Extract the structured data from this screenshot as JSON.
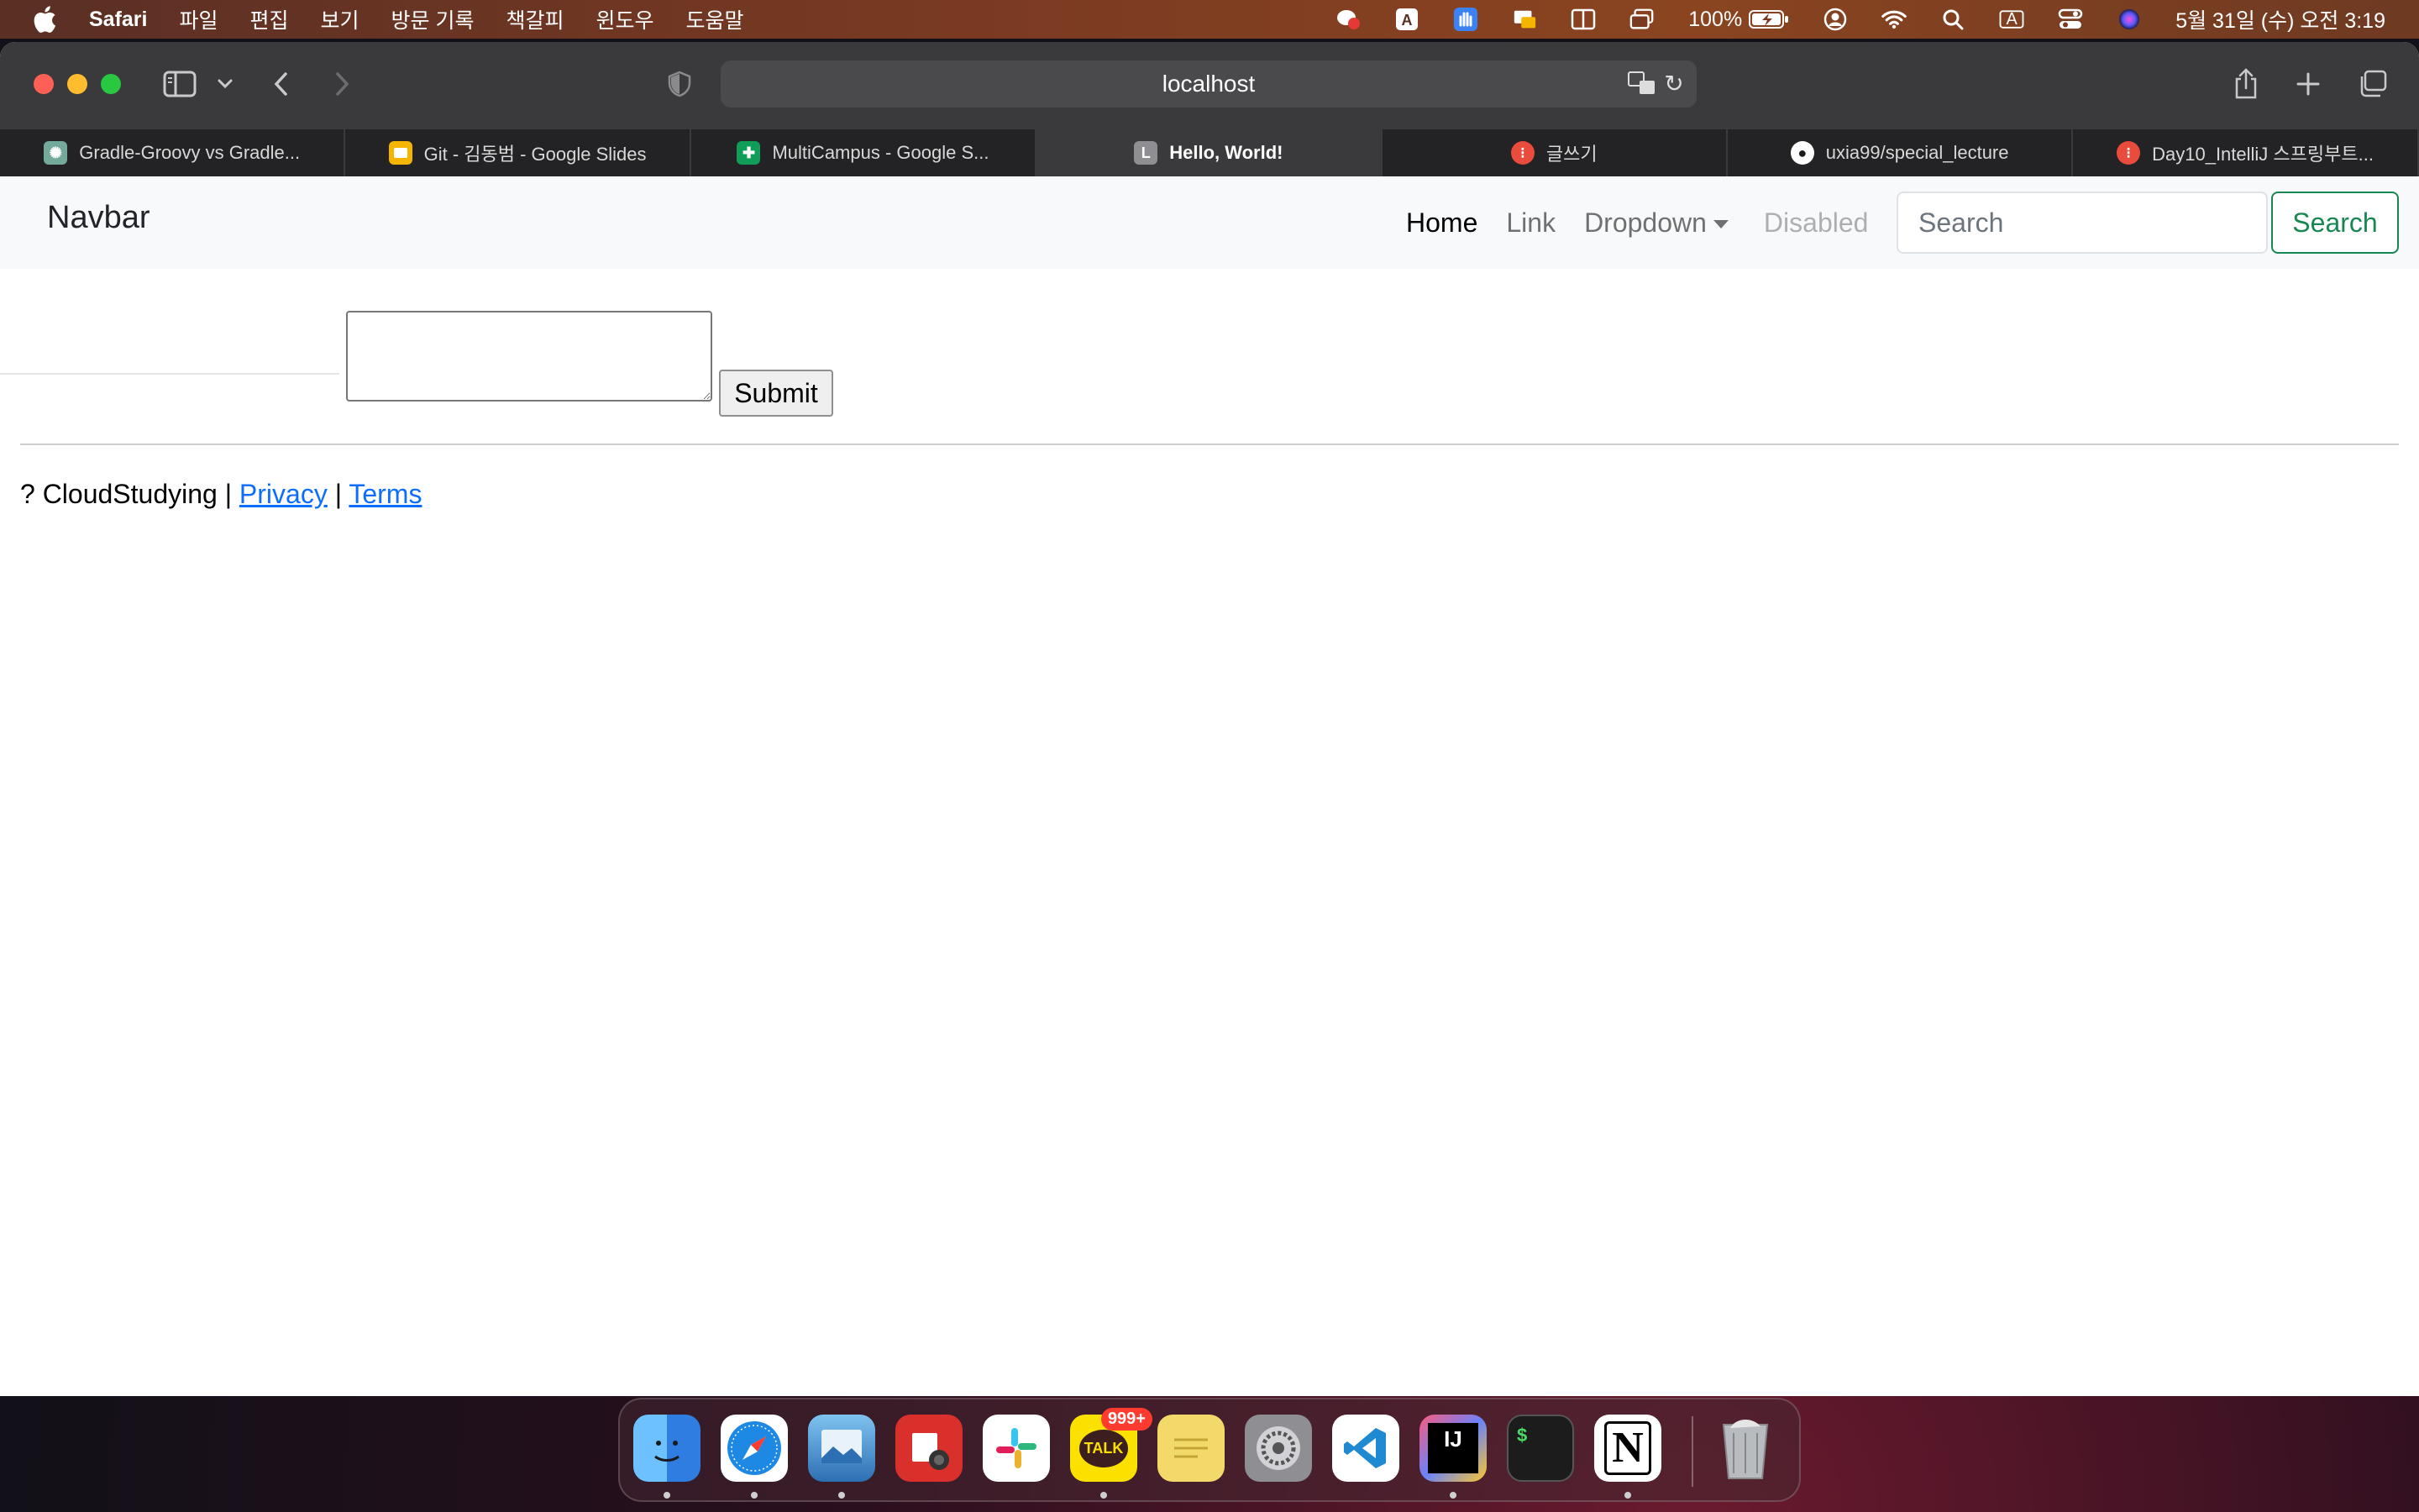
{
  "menubar": {
    "app_name": "Safari",
    "menus": [
      "파일",
      "편집",
      "보기",
      "방문 기록",
      "책갈피",
      "윈도우",
      "도움말"
    ],
    "battery": "100%",
    "datetime": "5월 31일 (수) 오전 3:19",
    "input_source": "A"
  },
  "browser": {
    "address": "localhost",
    "tabs": [
      {
        "title": "Gradle-Groovy vs Gradle...",
        "icon": "chatgpt-icon",
        "color": "#74aa9c"
      },
      {
        "title": "Git - 김동범 - Google Slides",
        "icon": "google-slides-icon",
        "color": "#f4b400"
      },
      {
        "title": "MultiCampus - Google S...",
        "icon": "google-sheets-icon",
        "color": "#0f9d58"
      },
      {
        "title": "Hello, World!",
        "icon": "letter-l-icon",
        "color": "#8e8e93",
        "letter": "L"
      },
      {
        "title": "글쓰기",
        "icon": "velog-icon",
        "color": "#e94b3c"
      },
      {
        "title": "uxia99/special_lecture",
        "icon": "github-icon",
        "color": "#ffffff"
      },
      {
        "title": "Day10_IntelliJ 스프링부트...",
        "icon": "velog-icon",
        "color": "#e94b3c"
      }
    ]
  },
  "page": {
    "navbar": {
      "brand": "Navbar",
      "links": {
        "home": "Home",
        "link": "Link",
        "dropdown": "Dropdown",
        "disabled": "Disabled"
      },
      "search_placeholder": "Search",
      "search_button": "Search"
    },
    "form": {
      "submit_label": "Submit"
    },
    "footer": {
      "prefix": "? CloudStudying | ",
      "privacy": "Privacy",
      "separator": " | ",
      "terms": "Terms"
    }
  },
  "dock": {
    "apps": [
      {
        "name": "finder",
        "color": "#3a8ef6"
      },
      {
        "name": "safari",
        "color": "#1e88e5"
      },
      {
        "name": "preview",
        "color": "#4fa3e0"
      },
      {
        "name": "photo-booth",
        "color": "#d9302c"
      },
      {
        "name": "slack",
        "color": "#ffffff"
      },
      {
        "name": "kakaotalk",
        "color": "#fae100",
        "label": "TALK",
        "badge": "999+"
      },
      {
        "name": "stickies",
        "color": "#f3d86a"
      },
      {
        "name": "system-settings",
        "color": "#8e8e93"
      },
      {
        "name": "vscode",
        "color": "#ffffff"
      },
      {
        "name": "intellij",
        "color": "#1a1a1a",
        "label": "IJ"
      },
      {
        "name": "terminal",
        "color": "#1c1c1c",
        "label": "$"
      },
      {
        "name": "notion",
        "color": "#ffffff",
        "label": "N"
      },
      {
        "name": "trash",
        "color": "#9ea3a8"
      }
    ]
  }
}
